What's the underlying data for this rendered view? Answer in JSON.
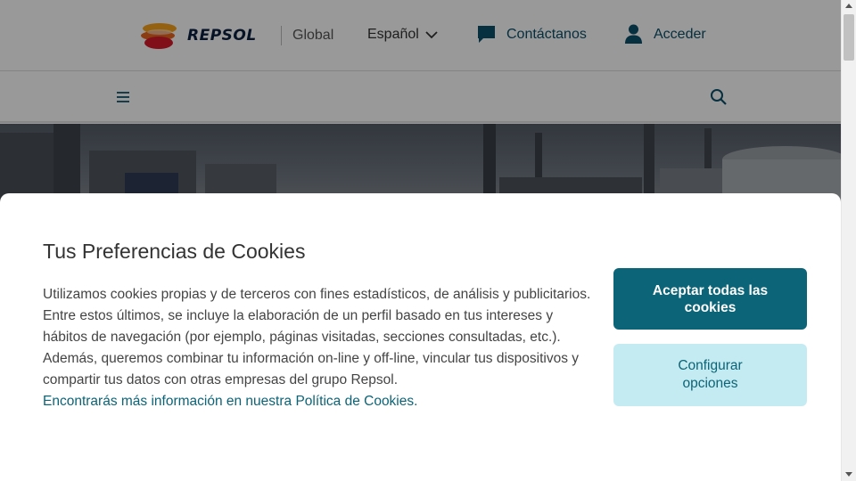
{
  "header": {
    "brand": "REPSOL",
    "region": "Global",
    "language": "Español",
    "contact_label": "Contáctanos",
    "login_label": "Acceder",
    "icons": {
      "logo": "repsol-logo",
      "language": "chevron-down-icon",
      "contact": "chat-bubble-icon",
      "login": "user-icon",
      "menu": "hamburger-menu-icon",
      "search": "search-icon"
    }
  },
  "cookies": {
    "title": "Tus Preferencias de Cookies",
    "paragraph_1": "Utilizamos cookies propias y de terceros con fines estadísticos, de análisis y publicitarios.",
    "paragraph_2": "Entre estos últimos, se incluye la elaboración de un perfil basado en tus intereses y hábitos de navegación (por ejemplo, páginas visitadas, secciones consultadas, etc.).",
    "paragraph_3": "Además, queremos combinar tu información on-line y off-line, vincular tus dispositivos y compartir tus datos con otras empresas del grupo Repsol.",
    "policy_link": "Encontrarás más información en nuestra Política de Cookies.",
    "accept_button": "Aceptar todas las cookies",
    "configure_button": "Configurar opciones"
  },
  "colors": {
    "primary": "#0b6477",
    "primary_light": "#c5ebf2",
    "link": "#0b6477",
    "brand_navy": "#0b1f3f",
    "brand_orange": "#f28c00",
    "brand_red": "#d7192b"
  }
}
